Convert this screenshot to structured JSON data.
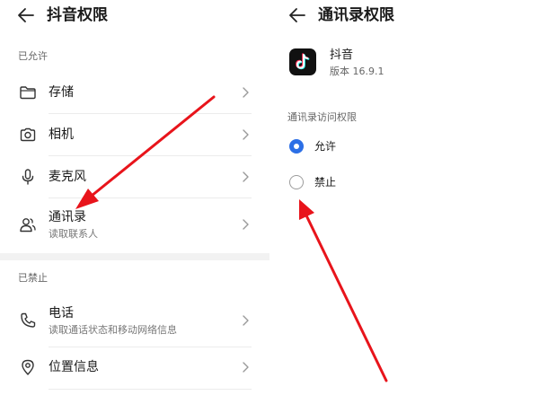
{
  "left": {
    "title": "抖音权限",
    "allowed_label": "已允许",
    "denied_label": "已禁止",
    "allowed_items": [
      {
        "label": "存储",
        "sub": ""
      },
      {
        "label": "相机",
        "sub": ""
      },
      {
        "label": "麦克风",
        "sub": ""
      },
      {
        "label": "通讯录",
        "sub": "读取联系人"
      }
    ],
    "denied_items": [
      {
        "label": "电话",
        "sub": "读取通话状态和移动网络信息"
      },
      {
        "label": "位置信息",
        "sub": ""
      }
    ]
  },
  "right": {
    "title": "通讯录权限",
    "app": {
      "name": "抖音",
      "version": "版本 16.9.1"
    },
    "section_label": "通讯录访问权限",
    "options": [
      {
        "label": "允许",
        "selected": true
      },
      {
        "label": "禁止",
        "selected": false
      }
    ]
  },
  "colors": {
    "annotation_arrow": "#e8141b",
    "radio_accent": "#2c6fe6"
  },
  "icons": [
    "back-arrow-icon",
    "folder-icon",
    "camera-icon",
    "microphone-icon",
    "contacts-icon",
    "phone-icon",
    "location-pin-icon",
    "chevron-right-icon",
    "tiktok-logo-icon"
  ]
}
